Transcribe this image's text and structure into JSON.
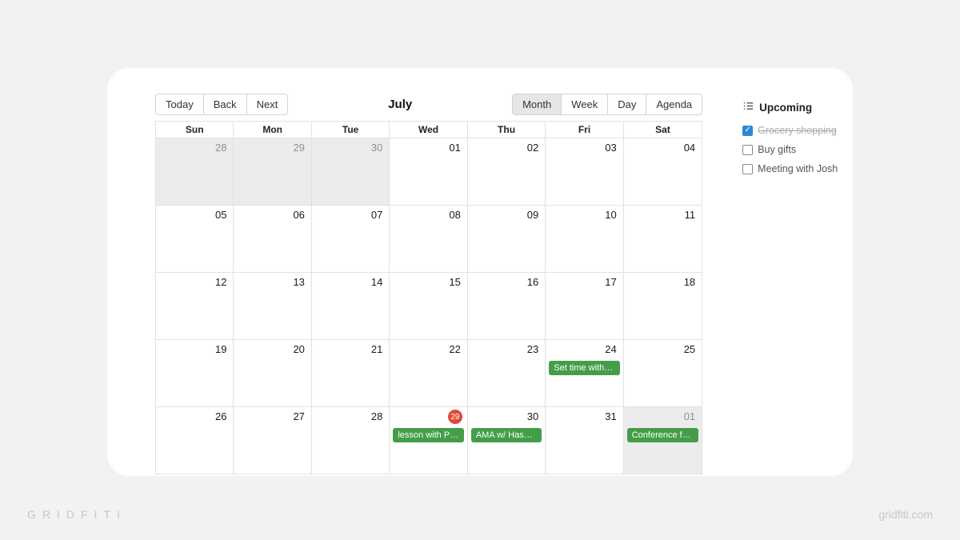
{
  "watermark": {
    "brand": "GRIDFITI",
    "site": "gridfiti.com"
  },
  "toolbar": {
    "nav": {
      "today": "Today",
      "back": "Back",
      "next": "Next"
    },
    "title": "July",
    "views": {
      "month": "Month",
      "week": "Week",
      "day": "Day",
      "agenda": "Agenda"
    },
    "active_view": "month"
  },
  "weekdays": [
    "Sun",
    "Mon",
    "Tue",
    "Wed",
    "Thu",
    "Fri",
    "Sat"
  ],
  "rows": [
    [
      {
        "num": "28",
        "out": true
      },
      {
        "num": "29",
        "out": true
      },
      {
        "num": "30",
        "out": true
      },
      {
        "num": "01"
      },
      {
        "num": "02"
      },
      {
        "num": "03"
      },
      {
        "num": "04"
      }
    ],
    [
      {
        "num": "05"
      },
      {
        "num": "06"
      },
      {
        "num": "07"
      },
      {
        "num": "08"
      },
      {
        "num": "09"
      },
      {
        "num": "10"
      },
      {
        "num": "11"
      }
    ],
    [
      {
        "num": "12"
      },
      {
        "num": "13"
      },
      {
        "num": "14"
      },
      {
        "num": "15"
      },
      {
        "num": "16"
      },
      {
        "num": "17"
      },
      {
        "num": "18"
      }
    ],
    [
      {
        "num": "19"
      },
      {
        "num": "20"
      },
      {
        "num": "21"
      },
      {
        "num": "22"
      },
      {
        "num": "23"
      },
      {
        "num": "24",
        "event": "Set time with Li…"
      },
      {
        "num": "25"
      }
    ],
    [
      {
        "num": "26"
      },
      {
        "num": "27"
      },
      {
        "num": "28"
      },
      {
        "num": "29",
        "today": true,
        "event": "lesson with Prof…"
      },
      {
        "num": "30",
        "event": "AMA w/ Hasque…"
      },
      {
        "num": "31"
      },
      {
        "num": "01",
        "out": true,
        "event": "Conference for …"
      }
    ]
  ],
  "sidebar": {
    "heading": "Upcoming",
    "tasks": [
      {
        "label": "Grocery shopping",
        "done": true
      },
      {
        "label": "Buy gifts",
        "done": false
      },
      {
        "label": "Meeting with Josh",
        "done": false
      }
    ]
  },
  "colors": {
    "event_bg": "#449e48",
    "today_bg": "#e04a3a",
    "check_bg": "#2f88d6"
  }
}
